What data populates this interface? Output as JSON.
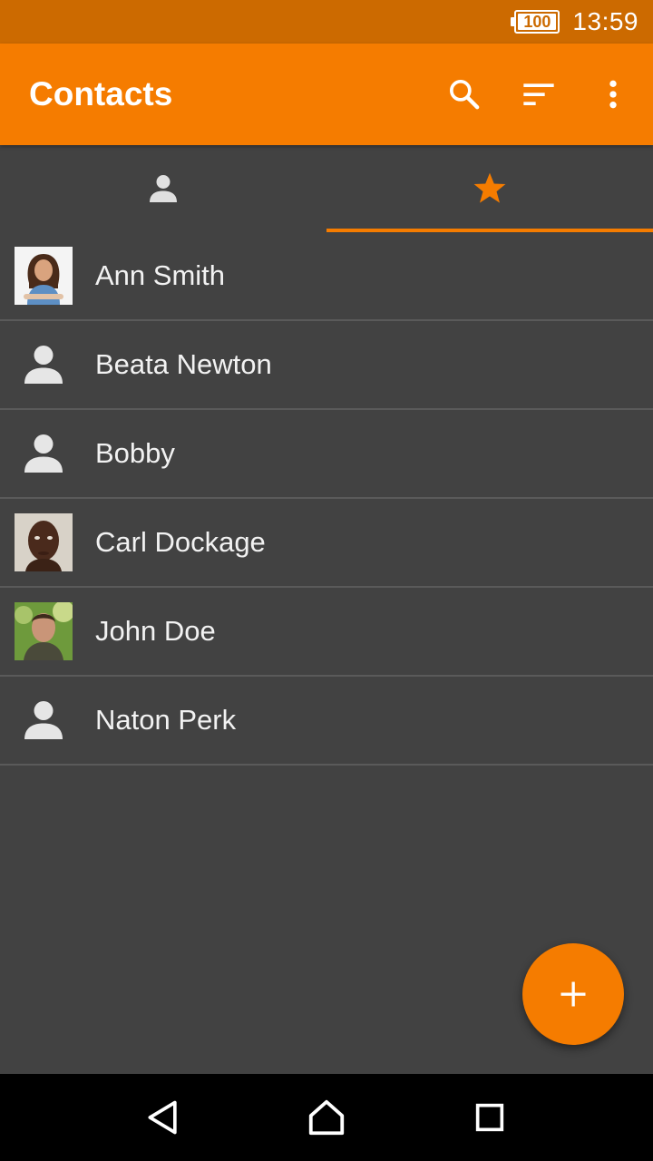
{
  "status_bar": {
    "battery": "100",
    "time": "13:59"
  },
  "app_bar": {
    "title": "Contacts",
    "actions": [
      "search-icon",
      "sort-icon",
      "more-vert-icon"
    ]
  },
  "tabs": [
    {
      "icon": "person-icon",
      "active": false
    },
    {
      "icon": "star-icon",
      "active": true
    }
  ],
  "contacts": [
    {
      "name": "Ann Smith",
      "avatar": "photo"
    },
    {
      "name": "Beata Newton",
      "avatar": "person-icon"
    },
    {
      "name": "Bobby",
      "avatar": "person-icon"
    },
    {
      "name": "Carl Dockage",
      "avatar": "photo"
    },
    {
      "name": "John Doe",
      "avatar": "photo"
    },
    {
      "name": "Naton Perk",
      "avatar": "person-icon"
    }
  ],
  "fab": {
    "icon": "add-icon"
  },
  "nav_bar": [
    "back-icon",
    "home-icon",
    "recents-icon"
  ],
  "colors": {
    "accent": "#f57c00",
    "status_bar": "#cc6a00",
    "background": "#424242"
  }
}
